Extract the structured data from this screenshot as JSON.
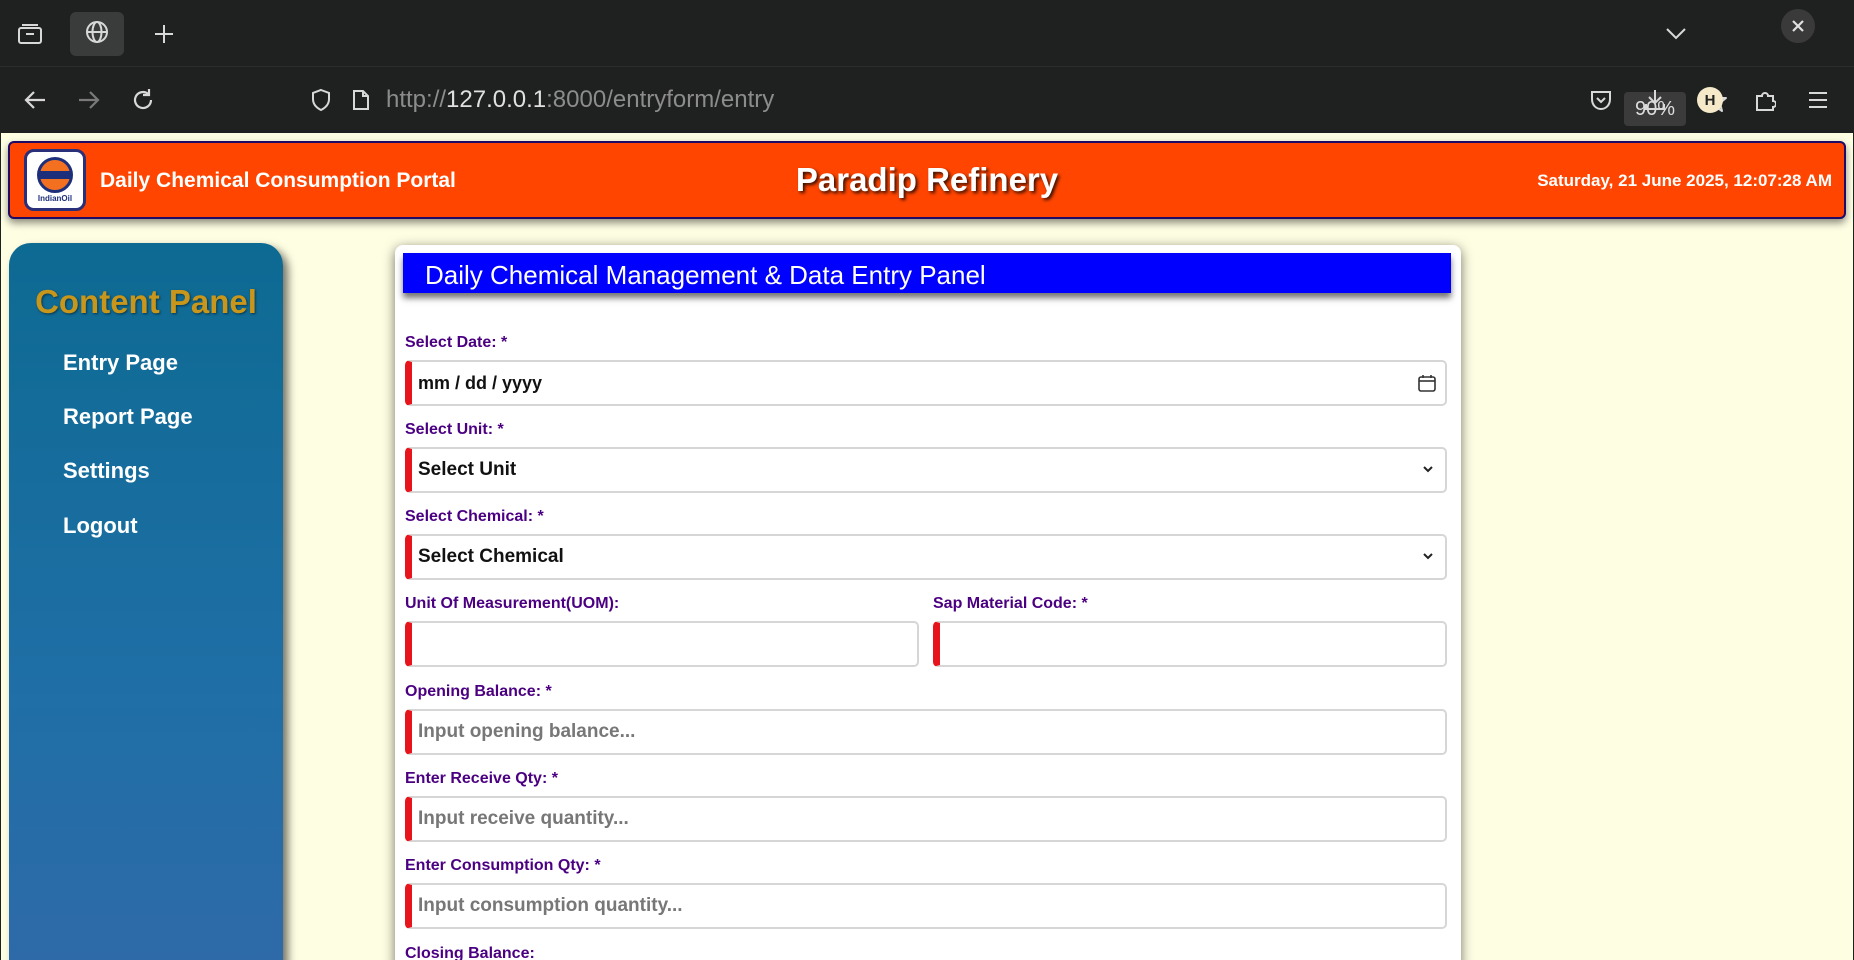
{
  "browser": {
    "url_scheme": "http://",
    "url_host": "127.0.0.1",
    "url_rest": ":8000/entryform/entry",
    "zoom": "90%",
    "profile_initial": "H"
  },
  "header": {
    "portal_name": "Daily Chemical Consumption Portal",
    "site_title": "Paradip Refinery",
    "datetime": "Saturday, 21 June 2025, 12:07:28 AM",
    "logo_text": "IndianOil"
  },
  "sidebar": {
    "title": "Content Panel",
    "items": [
      {
        "label": "Entry Page"
      },
      {
        "label": "Report Page"
      },
      {
        "label": "Settings"
      },
      {
        "label": "Logout"
      }
    ]
  },
  "form": {
    "panel_title": "Daily Chemical Management & Data Entry Panel",
    "date": {
      "label": "Select Date: *",
      "value": "mm / dd / yyyy"
    },
    "unit": {
      "label": "Select Unit: *",
      "value": "Select Unit"
    },
    "chemical": {
      "label": "Select Chemical: *",
      "value": "Select Chemical"
    },
    "uom": {
      "label": "Unit Of Measurement(UOM):",
      "value": ""
    },
    "sap": {
      "label": "Sap Material Code: *",
      "value": ""
    },
    "opening": {
      "label": "Opening Balance: *",
      "placeholder": "Input opening balance..."
    },
    "receive": {
      "label": "Enter Receive Qty: *",
      "placeholder": "Input receive quantity..."
    },
    "consumption": {
      "label": "Enter Consumption Qty: *",
      "placeholder": "Input consumption quantity..."
    },
    "closing": {
      "label": "Closing Balance:"
    }
  },
  "colors": {
    "header_bg": "#ff4500",
    "panel_head_bg": "#0000ff",
    "label_color": "#4b0082",
    "required_bar": "#e8141b",
    "sidebar_title": "#c8961a",
    "page_bg": "#fefee3"
  }
}
